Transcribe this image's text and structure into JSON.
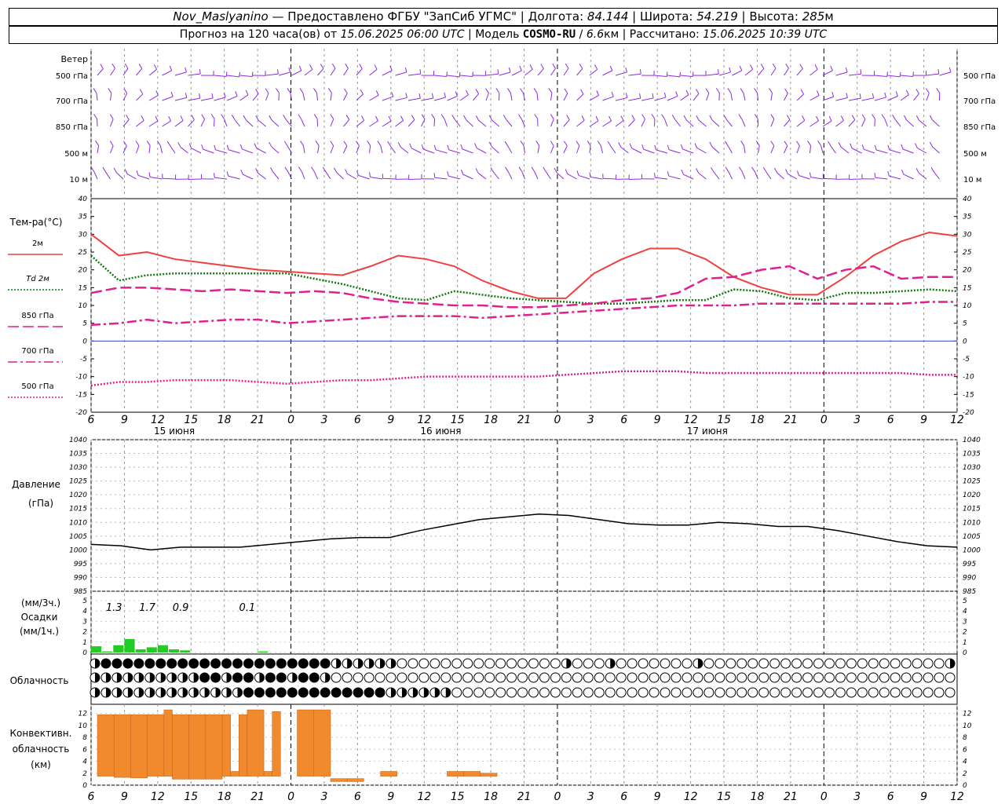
{
  "header": {
    "station": "Nov_Maslyanino",
    "provider": "— Предоставлено ФГБУ \"ЗапСиб УГМС\"",
    "lon_label": "Долгота:",
    "lon": "84.144",
    "lat_label": "Широта:",
    "lat": "54.219",
    "alt_label": "Высота:",
    "alt": "285",
    "alt_unit": "м",
    "forecast_label": "Прогноз на 120 часа(ов) от",
    "forecast_from": "15.06.2025 06:00 UTC",
    "model_label": "Модель",
    "model": "COSMO-RU",
    "model_res": "6.6",
    "model_res_unit": "км",
    "calc_label": "Рассчитано:",
    "calc_time": "15.06.2025 10:39 UTC"
  },
  "chart_data": [
    {
      "panel": "wind",
      "type": "barbs",
      "row_labels": [
        "Ветер",
        "500 гПа",
        "700 гПа",
        "850 гПа",
        "500 м",
        "10  м"
      ],
      "right_labels": [
        "500 гПа",
        "700 гПа",
        "850 гПа",
        "500 м",
        "10  м"
      ],
      "color": "#8a2be2"
    },
    {
      "panel": "temperature",
      "type": "line",
      "ylabel": "Тем-ра(°C)",
      "ylim": [
        -20,
        40
      ],
      "yticks": [
        -20,
        -15,
        -10,
        -5,
        0,
        5,
        10,
        15,
        20,
        25,
        30,
        35,
        40
      ],
      "x_hours": [
        6,
        9,
        12,
        15,
        18,
        21,
        0,
        3,
        6,
        9,
        12,
        15,
        18,
        21,
        0,
        3,
        6,
        9,
        12,
        15,
        18,
        21,
        0,
        3,
        6,
        9,
        12
      ],
      "day_labels": [
        "15 июня",
        "16 июня",
        "17 июня"
      ],
      "series": [
        {
          "name": "2м",
          "color": "#f04040",
          "style": "solid",
          "values": [
            30,
            24,
            25,
            23,
            22,
            21,
            20,
            19.5,
            19,
            18.5,
            21,
            24,
            23,
            21,
            17,
            14,
            12,
            12,
            19,
            23,
            26,
            26,
            23,
            18,
            15,
            13,
            13,
            18,
            24,
            28,
            30.5,
            29.5
          ]
        },
        {
          "name": "Td  2м",
          "color": "#117711",
          "style": "dotted",
          "values": [
            24,
            17,
            18.5,
            19,
            19,
            19,
            19,
            19,
            17.5,
            16,
            14,
            12,
            11.5,
            14,
            13,
            12,
            11.5,
            11,
            10.5,
            10.5,
            11,
            11.5,
            11.5,
            14.5,
            14,
            12,
            11.5,
            13.5,
            13.5,
            14,
            14.5,
            14
          ]
        },
        {
          "name": "850 гПа",
          "color": "#e0208c",
          "style": "longdash",
          "values": [
            13.5,
            15,
            15,
            14.5,
            14,
            14.5,
            14,
            13.5,
            14,
            13.5,
            12,
            11,
            10.5,
            10,
            10,
            9.5,
            9.5,
            10,
            10.5,
            11.5,
            12,
            13.5,
            17.5,
            18,
            20,
            21,
            17.5,
            20,
            21,
            17.5,
            18,
            18
          ]
        },
        {
          "name": "700 гПа",
          "color": "#e0208c",
          "style": "dashdot",
          "values": [
            4.5,
            5,
            6,
            5,
            5.5,
            6,
            6,
            5,
            5.5,
            6,
            6.5,
            7,
            7,
            7,
            6.5,
            7,
            7.5,
            8,
            8.5,
            9,
            9.5,
            10,
            10,
            10,
            10.5,
            10.5,
            10.5,
            10.5,
            10.5,
            10.5,
            11,
            11
          ]
        },
        {
          "name": "500 гПа",
          "color": "#e0208c",
          "style": "dotted",
          "values": [
            -12.5,
            -11.5,
            -11.5,
            -11,
            -11,
            -11,
            -11.5,
            -12,
            -11.5,
            -11,
            -11,
            -10.5,
            -10,
            -10,
            -10,
            -10,
            -10,
            -9.5,
            -9,
            -8.5,
            -8.5,
            -8.5,
            -9,
            -9,
            -9,
            -9,
            -9,
            -9,
            -9,
            -9,
            -9.5,
            -9.5
          ]
        }
      ]
    },
    {
      "panel": "pressure",
      "type": "line",
      "ylabel": "Давление",
      "unit": "(гПа)",
      "ylim": [
        985,
        1040
      ],
      "yticks": [
        985,
        990,
        995,
        1000,
        1005,
        1010,
        1015,
        1020,
        1025,
        1030,
        1035,
        1040
      ],
      "series": [
        {
          "name": "",
          "color": "#000000",
          "values": [
            1002,
            1001.5,
            1000,
            1001,
            1001,
            1001,
            1002,
            1003,
            1004,
            1004.5,
            1004.5,
            1007,
            1009,
            1011,
            1012,
            1013,
            1012.5,
            1011,
            1009.5,
            1009,
            1009,
            1010,
            1009.5,
            1008.5,
            1008.5,
            1007,
            1005,
            1003,
            1001.5,
            1001
          ]
        }
      ]
    },
    {
      "panel": "precipitation",
      "type": "bar",
      "ylabel_top": "(мм/3ч.)",
      "ylabel": "Осадки",
      "ylabel_bottom": "(мм/1ч.)",
      "ylim": [
        0,
        5
      ],
      "yticks": [
        0,
        1,
        2,
        3,
        4,
        5
      ],
      "totals_3h": [
        {
          "hour_index": 1,
          "value": "1.3"
        },
        {
          "hour_index": 2,
          "value": "1.7"
        },
        {
          "hour_index": 3,
          "value": "0.9"
        },
        {
          "hour_index": 5,
          "value": "0.1"
        }
      ],
      "hourly_values": [
        0.6,
        0.1,
        0.7,
        1.3,
        0.3,
        0.5,
        0.7,
        0.3,
        0.2,
        0,
        0,
        0,
        0,
        0,
        0,
        0.1
      ],
      "color": "#22cc22"
    },
    {
      "panel": "cloudiness",
      "type": "symbols",
      "ylabel": "Облачность",
      "rows": 3
    },
    {
      "panel": "convective",
      "type": "bar",
      "ylabel": "Конвективн. облачность (км)",
      "ylim": [
        0,
        13
      ],
      "yticks": [
        0,
        2,
        4,
        6,
        8,
        10,
        12
      ],
      "color": "#f08a2c",
      "bars": [
        {
          "from": 0,
          "to": 1,
          "bottom": 1.5,
          "top": 11.8
        },
        {
          "from": 1,
          "to": 2,
          "bottom": 1.3,
          "top": 11.8
        },
        {
          "from": 2,
          "to": 3,
          "bottom": 1.2,
          "top": 11.8
        },
        {
          "from": 3,
          "to": 4,
          "bottom": 1.5,
          "top": 11.8
        },
        {
          "from": 4,
          "to": 4.5,
          "bottom": 1.5,
          "top": 12.6
        },
        {
          "from": 4.5,
          "to": 5.5,
          "bottom": 1.0,
          "top": 11.8
        },
        {
          "from": 5.5,
          "to": 6.5,
          "bottom": 1.0,
          "top": 11.8
        },
        {
          "from": 6.5,
          "to": 7.5,
          "bottom": 1.0,
          "top": 11.8
        },
        {
          "from": 7.5,
          "to": 8,
          "bottom": 1.5,
          "top": 11.8
        },
        {
          "from": 8,
          "to": 8.5,
          "bottom": 1.5,
          "top": 2.3
        },
        {
          "from": 8.5,
          "to": 9,
          "bottom": 1.5,
          "top": 11.8
        },
        {
          "from": 9,
          "to": 10,
          "bottom": 1.5,
          "top": 12.6
        },
        {
          "from": 10,
          "to": 10.5,
          "bottom": 1.5,
          "top": 2.3
        },
        {
          "from": 10.5,
          "to": 11,
          "bottom": 1.5,
          "top": 12.3
        },
        {
          "from": 12,
          "to": 13,
          "bottom": 1.5,
          "top": 12.6
        },
        {
          "from": 13,
          "to": 14,
          "bottom": 1.5,
          "top": 12.6
        },
        {
          "from": 14,
          "to": 15,
          "bottom": 0.6,
          "top": 1.1
        },
        {
          "from": 15,
          "to": 16,
          "bottom": 0.6,
          "top": 1.1
        },
        {
          "from": 17,
          "to": 18,
          "bottom": 1.5,
          "top": 2.3
        },
        {
          "from": 21,
          "to": 22,
          "bottom": 1.5,
          "top": 2.3
        },
        {
          "from": 22,
          "to": 23,
          "bottom": 1.5,
          "top": 2.3
        },
        {
          "from": 23,
          "to": 24,
          "bottom": 1.5,
          "top": 2.0
        }
      ]
    }
  ]
}
